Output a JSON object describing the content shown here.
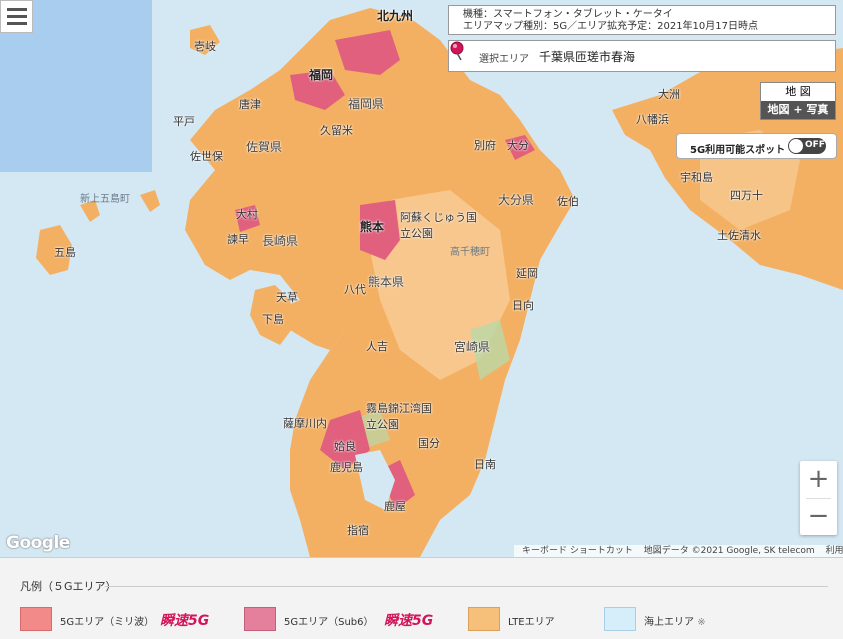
{
  "info": {
    "line1": "機種：スマートフォン・タブレット・ケータイ",
    "line2": "エリアマップ種別：5G／エリア拡充予定：2021年10月17日時点"
  },
  "selection": {
    "label": "選択エリア",
    "value": "千葉県匝瑳市春海"
  },
  "map_type": {
    "map": "地 図",
    "map_photo": "地図 + 写真"
  },
  "spot": {
    "label": "5G利用可能スポット",
    "state": "OFF"
  },
  "zoom": {
    "in": "+",
    "out": "−"
  },
  "google": "Google",
  "attribution": {
    "shortcuts": "キーボード ショートカット",
    "data": "地図データ ©2021 Google, SK telecom",
    "terms": "利用規約"
  },
  "places": {
    "kitakyushu": "北九州",
    "fukuoka_city": "福岡",
    "fukuoka": "福岡県",
    "saga": "佐賀県",
    "nagasaki": "長崎県",
    "kumamoto_city": "熊本",
    "kumamoto": "熊本県",
    "oita": "大分県",
    "oita_city": "大分",
    "miyazaki": "宮崎県",
    "kagoshima": "鹿児島",
    "karatsu": "唐津",
    "sasebo": "佐世保",
    "hirado": "平戸",
    "kurume": "久留米",
    "beppu": "別府",
    "saiki": "佐伯",
    "nobeoka": "延岡",
    "hyuga": "日向",
    "nichinan": "日南",
    "ojika": "大村",
    "isahaya": "諫早",
    "goto": "五島",
    "shinkamigoto": "新上五島町",
    "iki": "壱岐",
    "amakusa": "天草",
    "shimo": "下島",
    "yatsushiro": "八代",
    "hitoyoshi": "人吉",
    "satsumasendai": "薩摩川内",
    "kirishima": "霧島錦江湾国立公園",
    "aso": "阿蘇くじゅう国立公園",
    "takachiho": "高千穂町",
    "ozu": "大洲",
    "yawatahama": "八幡浜",
    "uwajima": "宇和島",
    "shimanto": "四万十",
    "tosashimizu": "土佐清水",
    "ibusuki": "指宿",
    "kanoya": "鹿屋",
    "kokubu": "国分",
    "aira": "姶良"
  },
  "legend": {
    "title": "凡例（５Gエリア）",
    "items": [
      {
        "label": "5Gエリア（ミリ波）",
        "color": "#f38a8a",
        "badge": "瞬速5G"
      },
      {
        "label": "5Gエリア（Sub6）",
        "color": "#e4809c",
        "badge": "瞬速5G"
      },
      {
        "label": "LTEエリア",
        "color": "#f7c07a",
        "badge": ""
      },
      {
        "label": "海上エリア",
        "note": "※",
        "color": "#d6edfa",
        "badge": ""
      }
    ]
  }
}
